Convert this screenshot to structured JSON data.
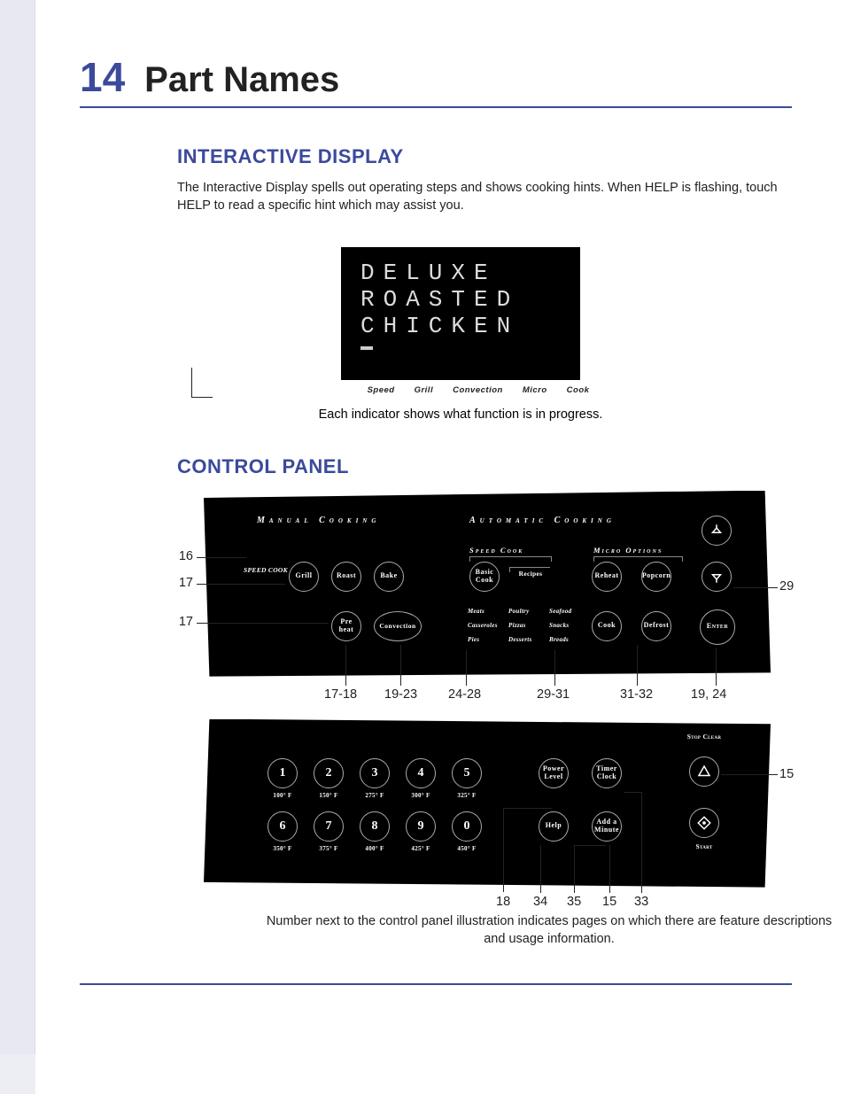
{
  "chapter": {
    "number": "14",
    "title": "Part Names"
  },
  "interactive_display": {
    "heading": "INTERACTIVE DISPLAY",
    "body": "The Interactive Display spells out operating steps and shows cooking hints. When HELP is flashing, touch HELP to read a specific hint which may assist you.",
    "screen_lines": [
      "DELUXE",
      "ROASTED",
      "CHICKEN"
    ],
    "indicators": [
      "Speed",
      "Grill",
      "Convection",
      "Micro",
      "Cook"
    ],
    "caption": "Each indicator shows what function is in progress."
  },
  "control_panel": {
    "heading": "CONTROL PANEL",
    "top": {
      "header_manual": "Manual Cooking",
      "header_auto": "Automatic Cooking",
      "sub_speedcook": "Speed Cook",
      "sub_micro_options": "Micro Options",
      "speed_cook_label": "SPEED COOK",
      "row1_manual": [
        "Grill",
        "Roast",
        "Bake"
      ],
      "row2_manual": [
        "Pre heat",
        "Convection"
      ],
      "speed_basic": "Basic Cook",
      "speed_recipes": "Recipes",
      "recipe_cats": [
        "Meats",
        "Poultry",
        "Seafood",
        "Casseroles",
        "Pizzas",
        "Snacks",
        "Pies",
        "Desserts",
        "Breads"
      ],
      "micro_row1": [
        "Reheat",
        "Popcorn"
      ],
      "micro_row2": [
        "Cook",
        "Defrost"
      ],
      "enter": "Enter",
      "left_refs": [
        "16",
        "17",
        "17"
      ],
      "right_ref": "29",
      "bottom_refs": [
        "17-18",
        "19-23",
        "24-28",
        "29-31",
        "31-32",
        "19, 24"
      ]
    },
    "bottom": {
      "numpad": [
        "1",
        "2",
        "3",
        "4",
        "5",
        "6",
        "7",
        "8",
        "9",
        "0"
      ],
      "temps": [
        "100° F",
        "150° F",
        "275° F",
        "300° F",
        "325° F",
        "350° F",
        "375° F",
        "400° F",
        "425° F",
        "450° F"
      ],
      "power_level": "Power Level",
      "timer_clock": "Timer Clock",
      "help": "Help",
      "add_minute": "Add a Minute",
      "stop_clear": "Stop Clear",
      "start": "Start",
      "right_ref": "15",
      "bottom_refs": [
        "18",
        "34",
        "35",
        "15",
        "33"
      ]
    },
    "footer_caption": "Number next to the control panel illustration indicates pages on which there are feature descriptions and usage information."
  }
}
